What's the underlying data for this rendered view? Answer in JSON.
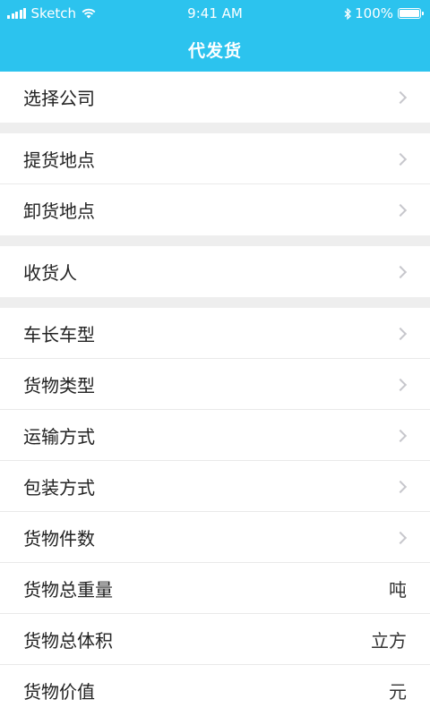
{
  "status_bar": {
    "carrier": "Sketch",
    "time": "9:41 AM",
    "battery": "100%"
  },
  "header": {
    "title": "代发货"
  },
  "groups": [
    {
      "rows": [
        {
          "label": "选择公司",
          "type": "chevron"
        }
      ]
    },
    {
      "rows": [
        {
          "label": "提货地点",
          "type": "chevron"
        },
        {
          "label": "卸货地点",
          "type": "chevron"
        }
      ]
    },
    {
      "rows": [
        {
          "label": "收货人",
          "type": "chevron"
        }
      ]
    },
    {
      "rows": [
        {
          "label": "车长车型",
          "type": "chevron"
        },
        {
          "label": "货物类型",
          "type": "chevron"
        },
        {
          "label": "运输方式",
          "type": "chevron"
        },
        {
          "label": "包装方式",
          "type": "chevron"
        },
        {
          "label": "货物件数",
          "type": "chevron"
        },
        {
          "label": "货物总重量",
          "unit": "吨"
        },
        {
          "label": "货物总体积",
          "unit": "立方"
        },
        {
          "label": "货物价值",
          "unit": "元"
        }
      ]
    }
  ],
  "colors": {
    "header": "#2cc3ee",
    "background": "#eeeeee",
    "chevron": "#c7c7cc"
  }
}
